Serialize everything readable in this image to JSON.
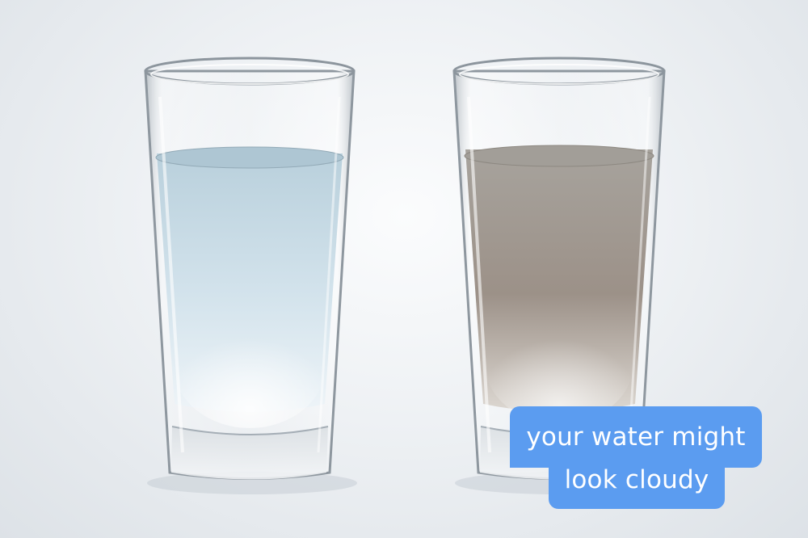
{
  "image": {
    "background_color": "#e9edf1",
    "subject": [
      {
        "name": "clear-water-glass",
        "liquid_color": "#c6d9e3",
        "fill_level": 0.8
      },
      {
        "name": "cloudy-water-glass",
        "liquid_color": "#9f9a93",
        "fill_level": 0.8
      }
    ]
  },
  "caption": {
    "line1": "your water might",
    "line2": "look cloudy",
    "background_color": "#5b9cf0",
    "text_color": "#ffffff"
  }
}
